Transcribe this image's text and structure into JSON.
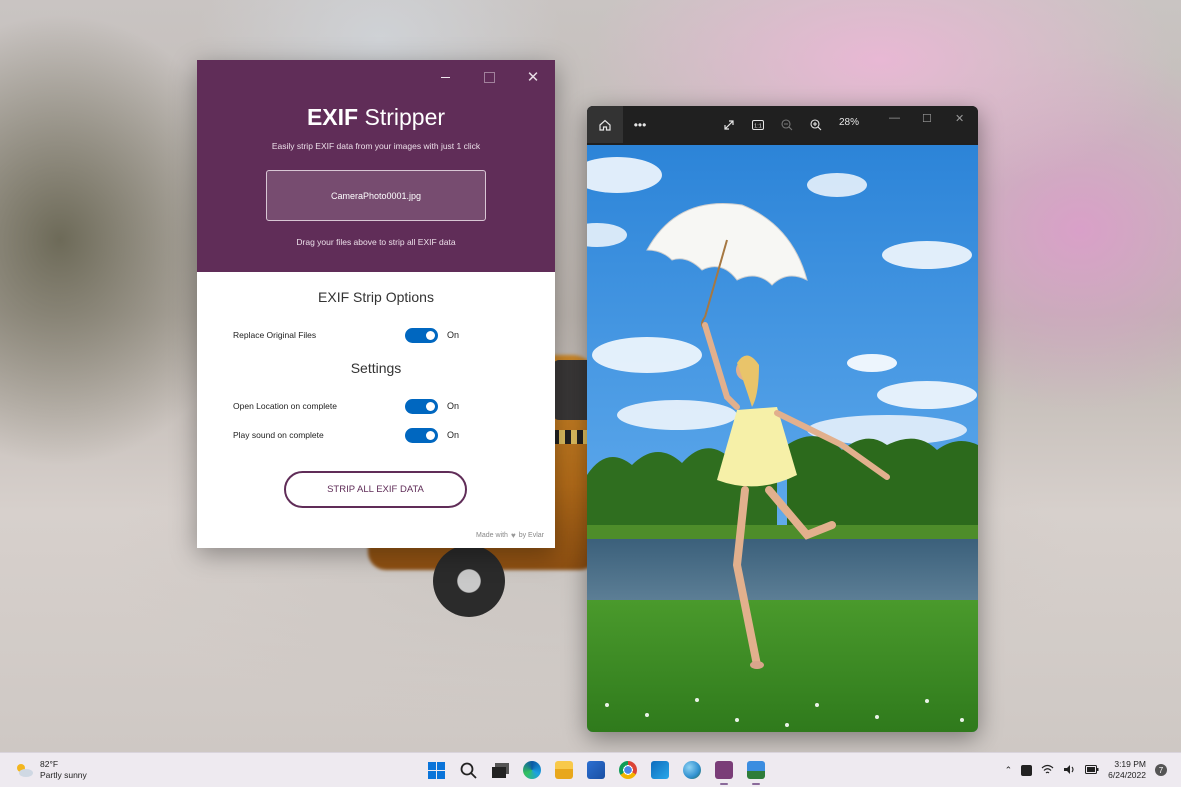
{
  "exif_app": {
    "title_bold": "EXIF",
    "title_rest": "Stripper",
    "subtitle": "Easily strip EXIF data from your images with just 1 click",
    "drop_zone_file": "CameraPhoto0001.jpg",
    "drop_hint": "Drag your files above to strip all EXIF data",
    "strip_options_title": "EXIF Strip Options",
    "settings_title": "Settings",
    "options": [
      {
        "label": "Replace Original Files",
        "state": "On"
      }
    ],
    "settings": [
      {
        "label": "Open Location on complete",
        "state": "On"
      },
      {
        "label": "Play sound on complete",
        "state": "On"
      }
    ],
    "strip_button": "STRIP ALL EXIF DATA",
    "credit_prefix": "Made with",
    "credit_suffix": "by Evlar",
    "accent_color": "#602d58"
  },
  "photo_viewer": {
    "zoom": "28%"
  },
  "taskbar": {
    "weather_temp": "82°F",
    "weather_desc": "Partly sunny",
    "time": "3:19 PM",
    "date": "6/24/2022",
    "notification_count": "7"
  }
}
